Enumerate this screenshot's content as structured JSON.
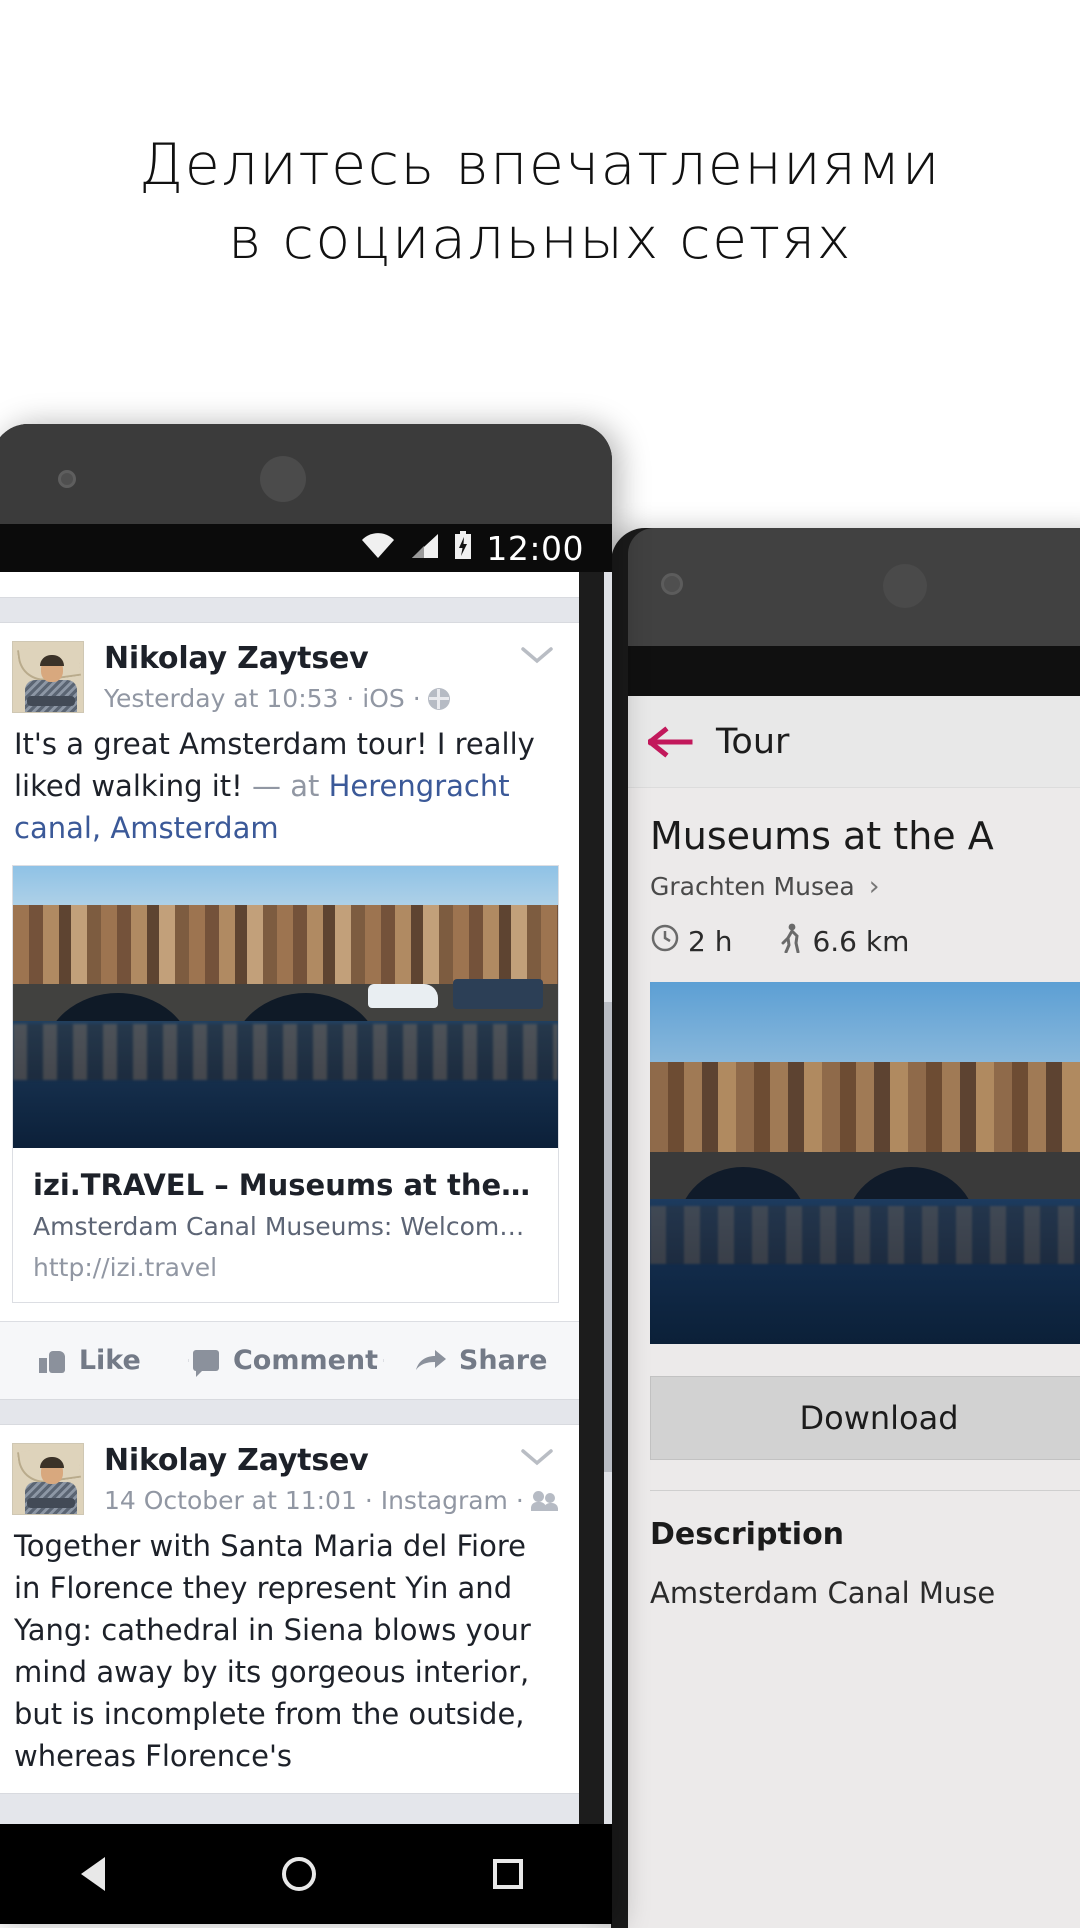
{
  "headline": {
    "line1": "Делитесь впечатлениями",
    "line2": "в социальных сетях"
  },
  "left_phone": {
    "status_bar": {
      "clock": "12:00",
      "icons": [
        "wifi-icon",
        "signal-icon",
        "battery-icon"
      ]
    },
    "nav_bar": {
      "back_label": "back-icon",
      "home_label": "home-icon",
      "recents_label": "recents-icon"
    },
    "feed": {
      "posts": [
        {
          "author": "Nikolay Zaytsev",
          "byline": "Yesterday at 10:53 · iOS ·",
          "privacy_icon": "globe-icon",
          "text_before": "It's a great Amsterdam tour! I really liked walking it!",
          "dash": "—",
          "at_word": "at",
          "location": "Herengracht canal, Amsterdam",
          "link_preview": {
            "title": "izi.TRAVEL – Museums at the Amsterdam ...",
            "description": "Amsterdam Canal Museums: Welcome to this inspiring ...",
            "url": "http://izi.travel"
          },
          "actions": {
            "like": "Like",
            "comment": "Comment",
            "share": "Share"
          }
        },
        {
          "author": "Nikolay Zaytsev",
          "byline": "14 October at 11:01 · Instagram ·",
          "privacy_icon": "friends-icon",
          "text": "Together with Santa Maria del Fiore in Florence they represent Yin and Yang: cathedral in Siena blows your mind away by its gorgeous interior, but is incomplete from the outside, whereas Florence's"
        }
      ]
    }
  },
  "right_phone": {
    "app_bar": {
      "back_icon": "back-arrow-icon",
      "title": "Tour",
      "accent_color": "#c2185b"
    },
    "tour": {
      "title": "Museums at the A",
      "publisher": "Grachten Musea",
      "publisher_chevron": "›",
      "duration_icon": "clock-icon",
      "duration": "2 h",
      "walk_icon": "walking-icon",
      "distance": "6.6 km",
      "download_label": "Download",
      "description_heading": "Description",
      "description_text": "Amsterdam Canal Muse"
    }
  }
}
